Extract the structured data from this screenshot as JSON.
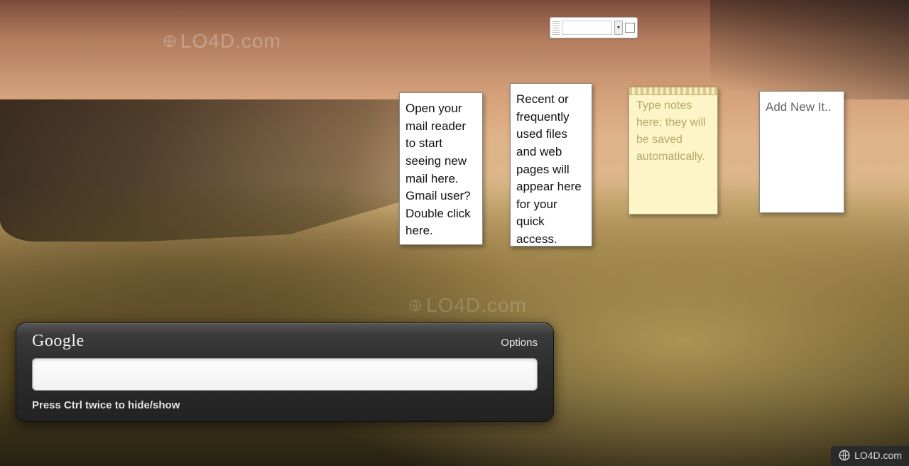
{
  "watermark": {
    "text": "LO4D.com"
  },
  "mini_toolbar": {
    "field_value": "",
    "dropdown_glyph": "▼"
  },
  "gadgets": {
    "mail": "Open your mail reader to start seeing new mail here. Gmail user? Double click here.",
    "recent": "Recent or frequently used files and web pages will appear here for your quick access.",
    "sticky": "Type notes here; they will be saved automatically.",
    "addnew": "Add New It.."
  },
  "google_bar": {
    "logo": "Google",
    "options": "Options",
    "input_value": "",
    "hint": "Press Ctrl twice to hide/show"
  }
}
